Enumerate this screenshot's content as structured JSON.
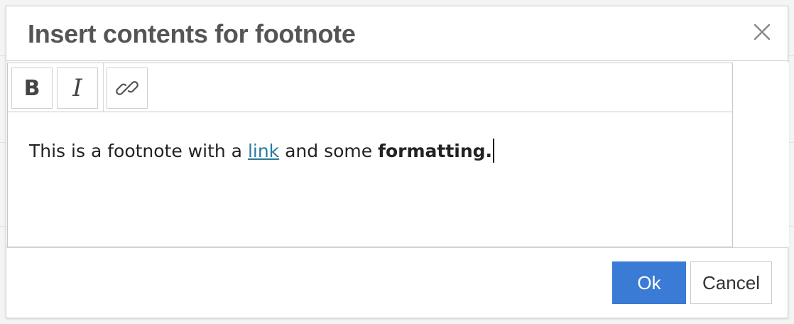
{
  "dialog": {
    "title": "Insert contents for footnote"
  },
  "toolbar": {
    "bold_label": "B",
    "italic_label": "I",
    "link_icon": "link-icon"
  },
  "editor": {
    "text_before": "This is a footnote with a ",
    "link_text": "link",
    "text_middle": " and some ",
    "bold_text": "formatting."
  },
  "footer": {
    "ok_label": "Ok",
    "cancel_label": "Cancel"
  },
  "colors": {
    "primary_button": "#3a7bd5",
    "link": "#2b7a9c",
    "title": "#555555"
  }
}
